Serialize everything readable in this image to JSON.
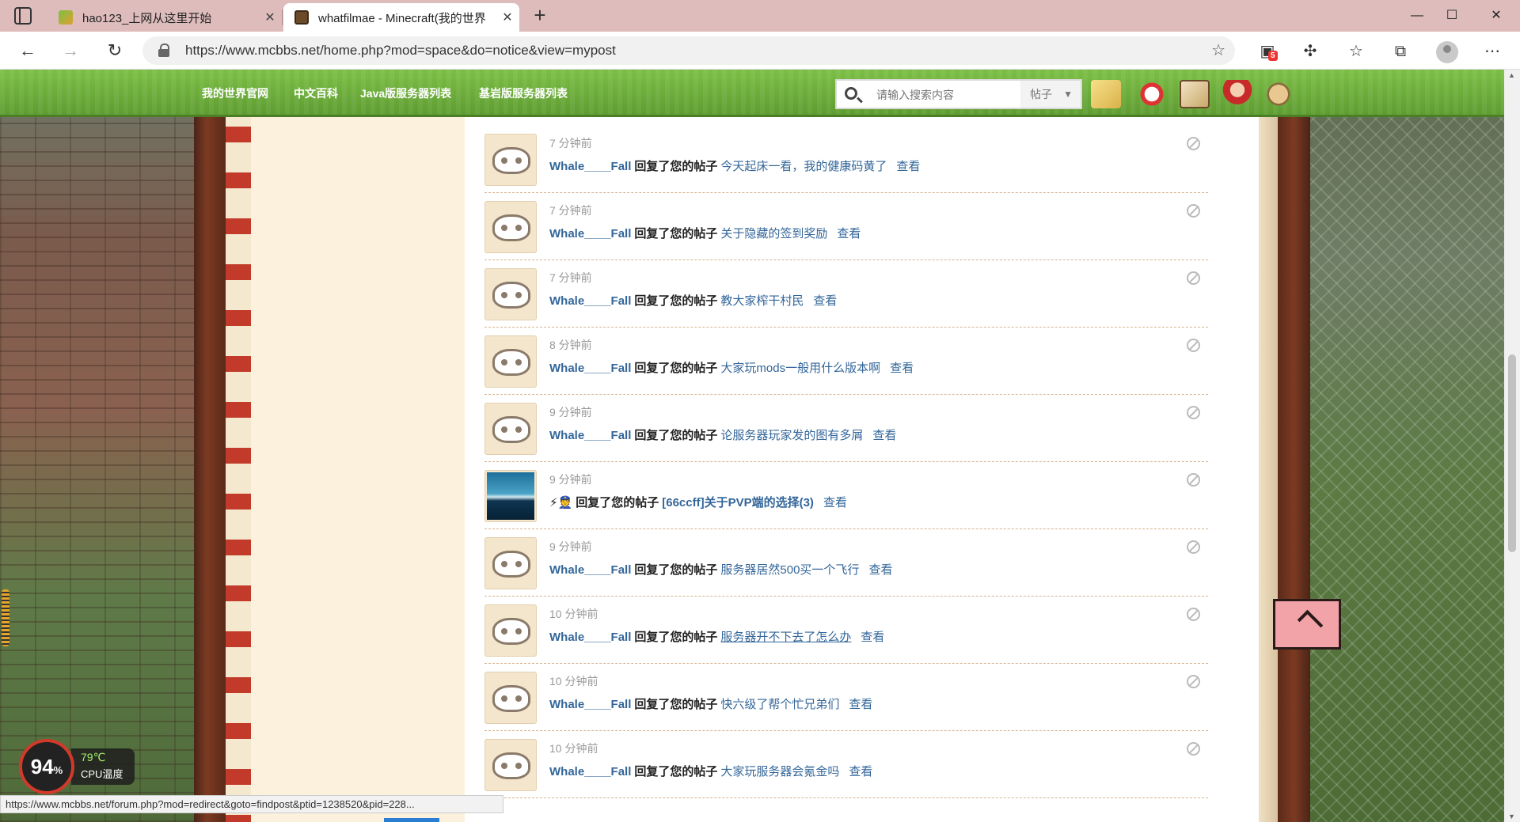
{
  "browser": {
    "tabs": [
      {
        "title": "hao123_上网从这里开始",
        "active": false,
        "favicon": "hao123-leaf-icon"
      },
      {
        "title": "whatfilmae - Minecraft(我的世界",
        "active": true,
        "favicon": "minecraft-block-icon"
      }
    ],
    "url": "https://www.mcbbs.net/home.php?mod=space&do=notice&view=mypost",
    "extension_badge": "5",
    "window_controls": {
      "minimize": "—",
      "maximize": "☐",
      "close": "✕"
    }
  },
  "site_nav": {
    "links": [
      "我的世界官网",
      "中文百科",
      "Java版服务器列表",
      "基岩版服务器列表"
    ],
    "search_placeholder": "请输入搜索内容",
    "search_scope": "帖子",
    "search_scope_arrow": "▼"
  },
  "notices": [
    {
      "time": "7 分钟前",
      "user": "Whale____Fall",
      "action": "回复了您的帖子",
      "post": "今天起床一看，我的健康码黄了",
      "view": "查看",
      "avatar": "skull"
    },
    {
      "time": "7 分钟前",
      "user": "Whale____Fall",
      "action": "回复了您的帖子",
      "post": "关于隐藏的签到奖励",
      "view": "查看",
      "avatar": "skull"
    },
    {
      "time": "7 分钟前",
      "user": "Whale____Fall",
      "action": "回复了您的帖子",
      "post": "教大家榨干村民",
      "view": "查看",
      "avatar": "skull"
    },
    {
      "time": "8 分钟前",
      "user": "Whale____Fall",
      "action": "回复了您的帖子",
      "post": "大家玩mods一般用什么版本啊",
      "view": "查看",
      "avatar": "skull"
    },
    {
      "time": "9 分钟前",
      "user": "Whale____Fall",
      "action": "回复了您的帖子",
      "post": "论服务器玩家发的图有多屑",
      "view": "查看",
      "avatar": "skull"
    },
    {
      "time": "9 分钟前",
      "user": "⚡👮",
      "action": "回复了您的帖子",
      "post": "[66ccff]关于PVP端的选择(3)",
      "view": "查看",
      "avatar": "sky"
    },
    {
      "time": "9 分钟前",
      "user": "Whale____Fall",
      "action": "回复了您的帖子",
      "post": "服务器居然500买一个飞行",
      "view": "查看",
      "avatar": "skull"
    },
    {
      "time": "10 分钟前",
      "user": "Whale____Fall",
      "action": "回复了您的帖子",
      "post": "服务器开不下去了怎么办",
      "view": "查看",
      "avatar": "skull"
    },
    {
      "time": "10 分钟前",
      "user": "Whale____Fall",
      "action": "回复了您的帖子",
      "post": "快六级了帮个忙兄弟们",
      "view": "查看",
      "avatar": "skull"
    },
    {
      "time": "10 分钟前",
      "user": "Whale____Fall",
      "action": "回复了您的帖子",
      "post": "大家玩服务器会氪金吗",
      "view": "查看",
      "avatar": "skull"
    }
  ],
  "status_bar_url": "https://www.mcbbs.net/forum.php?mod=redirect&goto=findpost&ptid=1238520&pid=228...",
  "cpu_widget": {
    "percent": "94",
    "percent_sign": "%",
    "temp": "79℃",
    "label": "CPU温度"
  },
  "colors": {
    "nav_green": "#6aad3a",
    "link_blue": "#336699",
    "panel_cream": "#fbf1dd",
    "pillar_brown": "#7c3a22"
  }
}
